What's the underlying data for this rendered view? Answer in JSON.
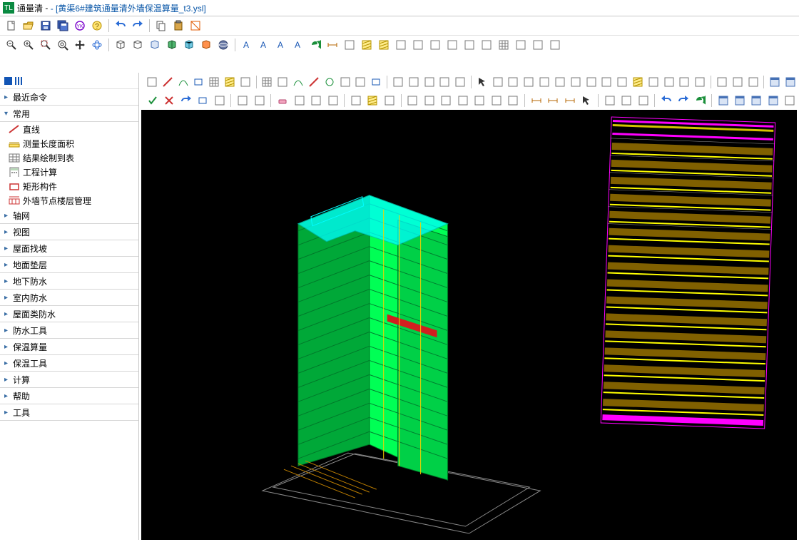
{
  "app": {
    "name": "通量清",
    "document": "- [黄渠6#建筑通量清外墙保温算量_t3.ysl]"
  },
  "sidebar": {
    "header_icons": [
      "grid-icon",
      "list-icon"
    ],
    "groups": [
      {
        "label": "最近命令",
        "expanded": false
      },
      {
        "label": "常用",
        "expanded": true,
        "items": [
          {
            "label": "直线",
            "icon": "line"
          },
          {
            "label": "测量长度面积",
            "icon": "dim"
          },
          {
            "label": "结果绘制到表",
            "icon": "table"
          },
          {
            "label": "工程计算",
            "icon": "calc"
          },
          {
            "label": "矩形构件",
            "icon": "rect"
          },
          {
            "label": "外墙节点楼层管理",
            "icon": "wall"
          }
        ]
      },
      {
        "label": "轴网",
        "expanded": false
      },
      {
        "label": "视图",
        "expanded": false
      },
      {
        "label": "屋面找坡",
        "expanded": false
      },
      {
        "label": "地面垫层",
        "expanded": false
      },
      {
        "label": "地下防水",
        "expanded": false
      },
      {
        "label": "室内防水",
        "expanded": false
      },
      {
        "label": "屋面类防水",
        "expanded": false
      },
      {
        "label": "防水工具",
        "expanded": false
      },
      {
        "label": "保温算量",
        "expanded": false
      },
      {
        "label": "保温工具",
        "expanded": false
      },
      {
        "label": "计算",
        "expanded": false
      },
      {
        "label": "帮助",
        "expanded": false
      },
      {
        "label": "工具",
        "expanded": false
      }
    ]
  },
  "toolbar1_icons": [
    "new-file",
    "open-file",
    "save",
    "save-all",
    "yk",
    "help",
    "sep",
    "undo",
    "redo",
    "sep",
    "copy",
    "paste",
    "measure-area"
  ],
  "toolbar2_icons": [
    "zoom-out",
    "zoom-in",
    "zoom-extents",
    "zoom-window",
    "pan",
    "orbit",
    "sep",
    "wireframe",
    "hidden-line",
    "box",
    "shaded",
    "shaded-edges",
    "realistic",
    "xray",
    "sep",
    "text-a",
    "text-ab",
    "text-bold",
    "text-italic",
    "refresh",
    "dimension",
    "leader",
    "hatch",
    "fill",
    "origin",
    "measure",
    "crosshair",
    "angle",
    "profile",
    "ucs",
    "grid",
    "align",
    "properties",
    "layer"
  ],
  "toolbar3_icons": [
    "point",
    "line",
    "arc",
    "rectangle",
    "grid-table",
    "rect-fill",
    "region",
    "sep",
    "gridline",
    "edge",
    "curve",
    "spline",
    "circle",
    "ellipse",
    "3pt",
    "rect2",
    "sep",
    "render",
    "sketch",
    "walk",
    "orbit3d",
    "camera",
    "sep",
    "select",
    "window-sel",
    "cross-sel",
    "filter",
    "copy2",
    "move",
    "rotate",
    "mirror",
    "trim",
    "extend",
    "fillet",
    "chamfer",
    "settings",
    "props",
    "check",
    "sep",
    "wall1",
    "wall2",
    "wall3",
    "sep",
    "view1",
    "view2"
  ],
  "toolbar4_icons": [
    "confirm",
    "cancel",
    "redo2",
    "rect-tool",
    "bars",
    "sep",
    "offset",
    "array",
    "sep",
    "erase",
    "scissors",
    "explode",
    "break",
    "sep",
    "poly",
    "hatch2",
    "region2",
    "sep",
    "door1",
    "door2",
    "window1",
    "window2",
    "corner",
    "tee-join",
    "cross-join",
    "sep",
    "dim-lin",
    "dim-ang",
    "dim-rad",
    "arrow",
    "sep",
    "find",
    "replace",
    "style",
    "sep",
    "undo-blue",
    "redo-blue",
    "refresh-blue",
    "sep",
    "panel1",
    "panel2",
    "panel3",
    "panel4",
    "profile2"
  ],
  "viewport": {
    "background": "#000000",
    "model_accent": "#00ff55",
    "model_highlight": "#00ffff",
    "panel_colors": [
      "#ff00ff",
      "#ffff00",
      "#ffffff",
      "#806000"
    ]
  }
}
